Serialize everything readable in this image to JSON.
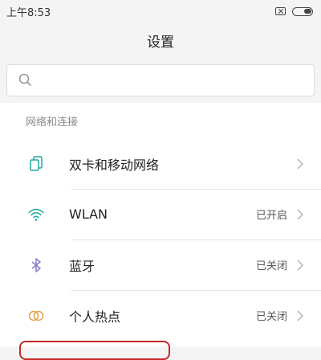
{
  "status_bar": {
    "time": "上午8:53",
    "icons": [
      "sim-off-icon",
      "battery-icon"
    ]
  },
  "header": {
    "title": "设置"
  },
  "search": {
    "placeholder": "",
    "icon": "search-icon"
  },
  "sections": [
    {
      "title": "网络和连接",
      "items": [
        {
          "label": "双卡和移动网络",
          "value": "",
          "icon": "dual-sim-icon"
        },
        {
          "label": "WLAN",
          "value": "已开启",
          "icon": "wifi-icon"
        },
        {
          "label": "蓝牙",
          "value": "已关闭",
          "icon": "bluetooth-icon"
        },
        {
          "label": "个人热点",
          "value": "已关闭",
          "icon": "hotspot-icon"
        }
      ]
    }
  ],
  "colors": {
    "accent": "#1fa7a2",
    "bluetooth": "#8e78c8",
    "hotspot": "#e0a24a",
    "highlight": "#c62828"
  }
}
